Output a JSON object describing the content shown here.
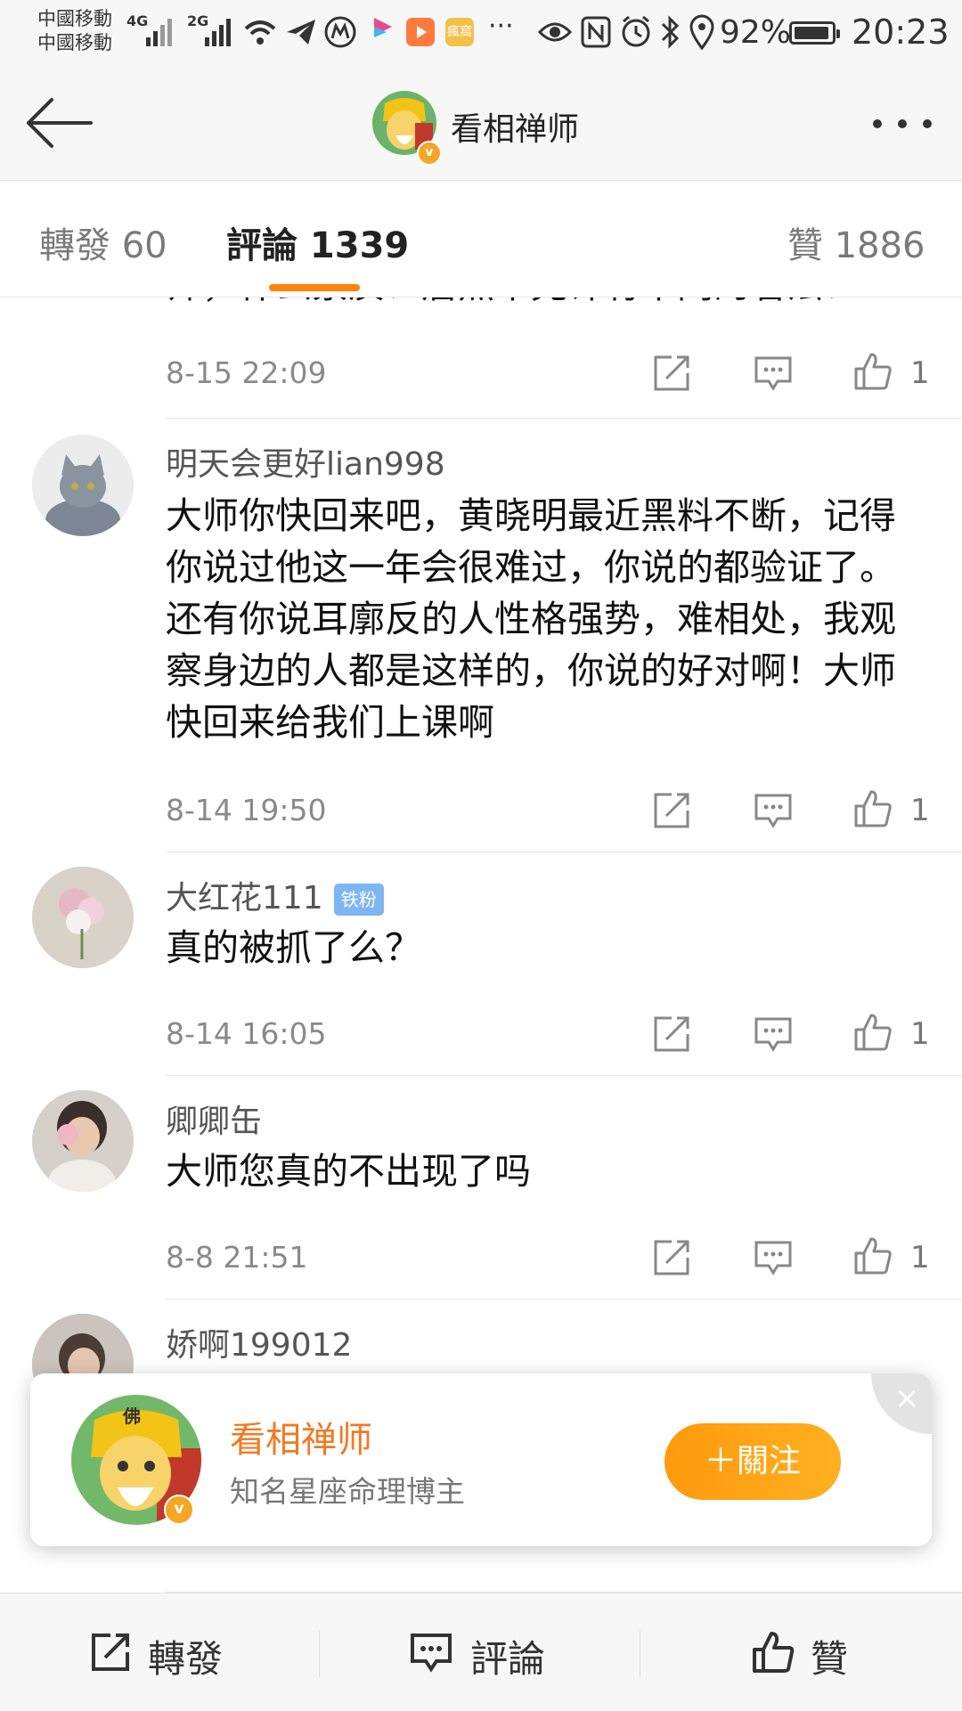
{
  "status": {
    "carrier_1": "中國移動",
    "carrier_2": "中國移動",
    "net_1": "4G",
    "net_2": "2G",
    "app_icon_label": "瘋窩",
    "dots": "···",
    "battery": "92%",
    "time": "20:23"
  },
  "header": {
    "title": "看相禅师",
    "verified_mark": "v"
  },
  "tabs": {
    "repost": "轉發 60",
    "comments": "評論 1339",
    "likes": "贊 1886"
  },
  "comments": [
    {
      "text": "师，什么素质？居然不允许有不同的看法？",
      "time": "8-15 22:09",
      "likes": "1"
    },
    {
      "name": "明天会更好lian998",
      "text": "大师你快回来吧，黄晓明最近黑料不断，记得你说过他这一年会很难过，你说的都验证了。还有你说耳廓反的人性格强势，难相处，我观察身边的人都是这样的，你说的好对啊！大师快回来给我们上课啊",
      "time": "8-14 19:50",
      "likes": "1"
    },
    {
      "name": "大红花111",
      "badge": "铁粉",
      "text": "真的被抓了么？",
      "time": "8-14 16:05",
      "likes": "1"
    },
    {
      "name": "卿卿缶",
      "text": "大师您真的不出现了吗",
      "time": "8-8 21:51",
      "likes": "1"
    },
    {
      "name": "娇啊199012"
    }
  ],
  "popup": {
    "avatar_char": "佛",
    "name": "看相禅师",
    "desc": "知名星座命理博主",
    "follow": "＋關注",
    "close": "×"
  },
  "bottom_bar": {
    "repost": "轉發",
    "comment": "評論",
    "like": "贊"
  },
  "colors": {
    "accent": "#ff8200",
    "follow_button": "#ff9a0e",
    "popup_name": "#f07a22",
    "fan_badge": "#7eb6f2"
  },
  "icons": {
    "back": "arrow-left-icon",
    "more": "more-dots-icon",
    "repost": "share-box-icon",
    "comment": "comment-bubble-icon",
    "like": "thumbs-up-icon",
    "close": "close-icon"
  }
}
